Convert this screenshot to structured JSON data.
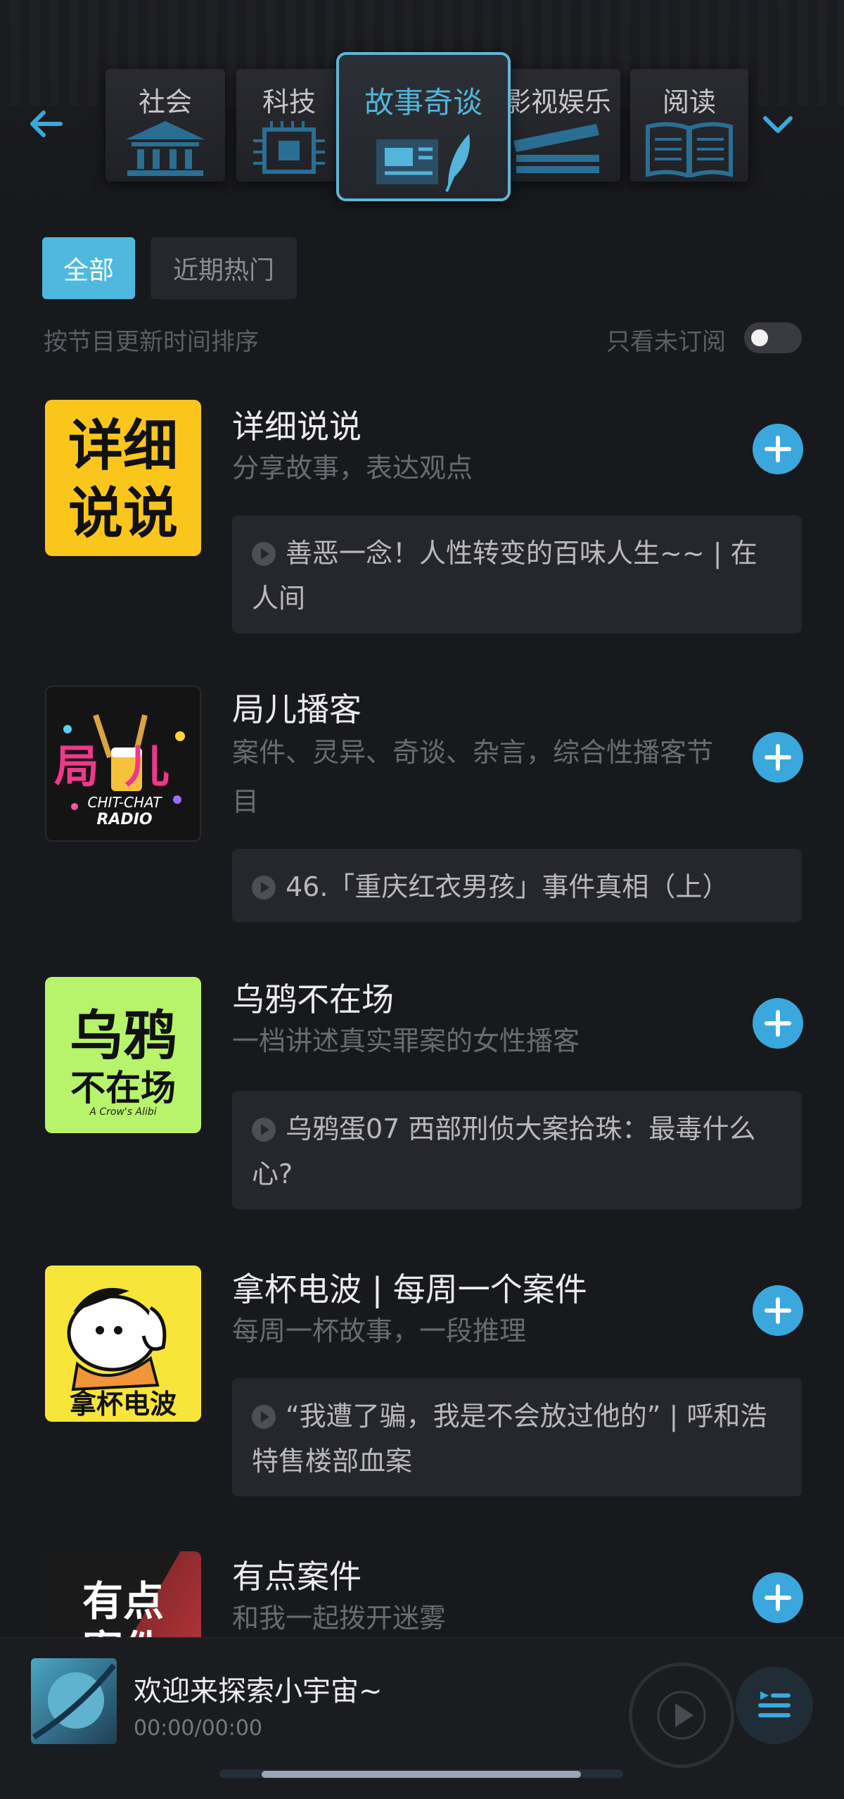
{
  "nav": {
    "categories": [
      {
        "label": "社会",
        "active": false
      },
      {
        "label": "科技",
        "active": false
      },
      {
        "label": "故事奇谈",
        "active": true
      },
      {
        "label": "影视娱乐",
        "active": false
      },
      {
        "label": "阅读",
        "active": false
      }
    ],
    "accent_color": "#52b5d9"
  },
  "filters": {
    "chips": [
      "全部",
      "近期热门"
    ],
    "selected": "全部",
    "sort_text": "按节目更新时间排序",
    "unsubscribed_only_label": "只看未订阅",
    "unsubscribed_only": false
  },
  "podcasts": [
    {
      "title": "详细说说",
      "desc": "分享故事，表达观点",
      "cover_text": [
        "详细",
        "说说"
      ],
      "episode": "善恶一念！人性转变的百味人生~~ | 在人间"
    },
    {
      "title": "局儿播客",
      "desc": "案件、灵异、奇谈、杂言，综合性播客节目",
      "cover_text": [
        "局儿",
        "CHIT-CHAT",
        "RADIO"
      ],
      "episode": "46.「重庆红衣男孩」事件真相（上）"
    },
    {
      "title": "乌鸦不在场",
      "desc": "一档讲述真实罪案的女性播客",
      "cover_text": [
        "乌鸦",
        "不在场",
        "A Crow's Alibi"
      ],
      "episode": "乌鸦蛋07 西部刑侦大案拾珠：最毒什么心?"
    },
    {
      "title": "拿杯电波 | 每周一个案件",
      "desc": "每周一杯故事，一段推理",
      "cover_text": [
        "拿杯电波"
      ],
      "episode": "“我遭了骗，我是不会放过他的” | 呼和浩特售楼部血案"
    },
    {
      "title": "有点案件",
      "desc": "和我一起拨开迷雾",
      "cover_text": [
        "有点",
        "案件"
      ],
      "episode": ""
    }
  ],
  "player": {
    "title": "欢迎来探索小宇宙~",
    "time": "00:00/00:00"
  },
  "icons": {
    "back": "arrow-left-icon",
    "dropdown": "chevron-down-icon",
    "add": "plus-icon",
    "play": "play-icon",
    "playlist": "playlist-icon"
  }
}
